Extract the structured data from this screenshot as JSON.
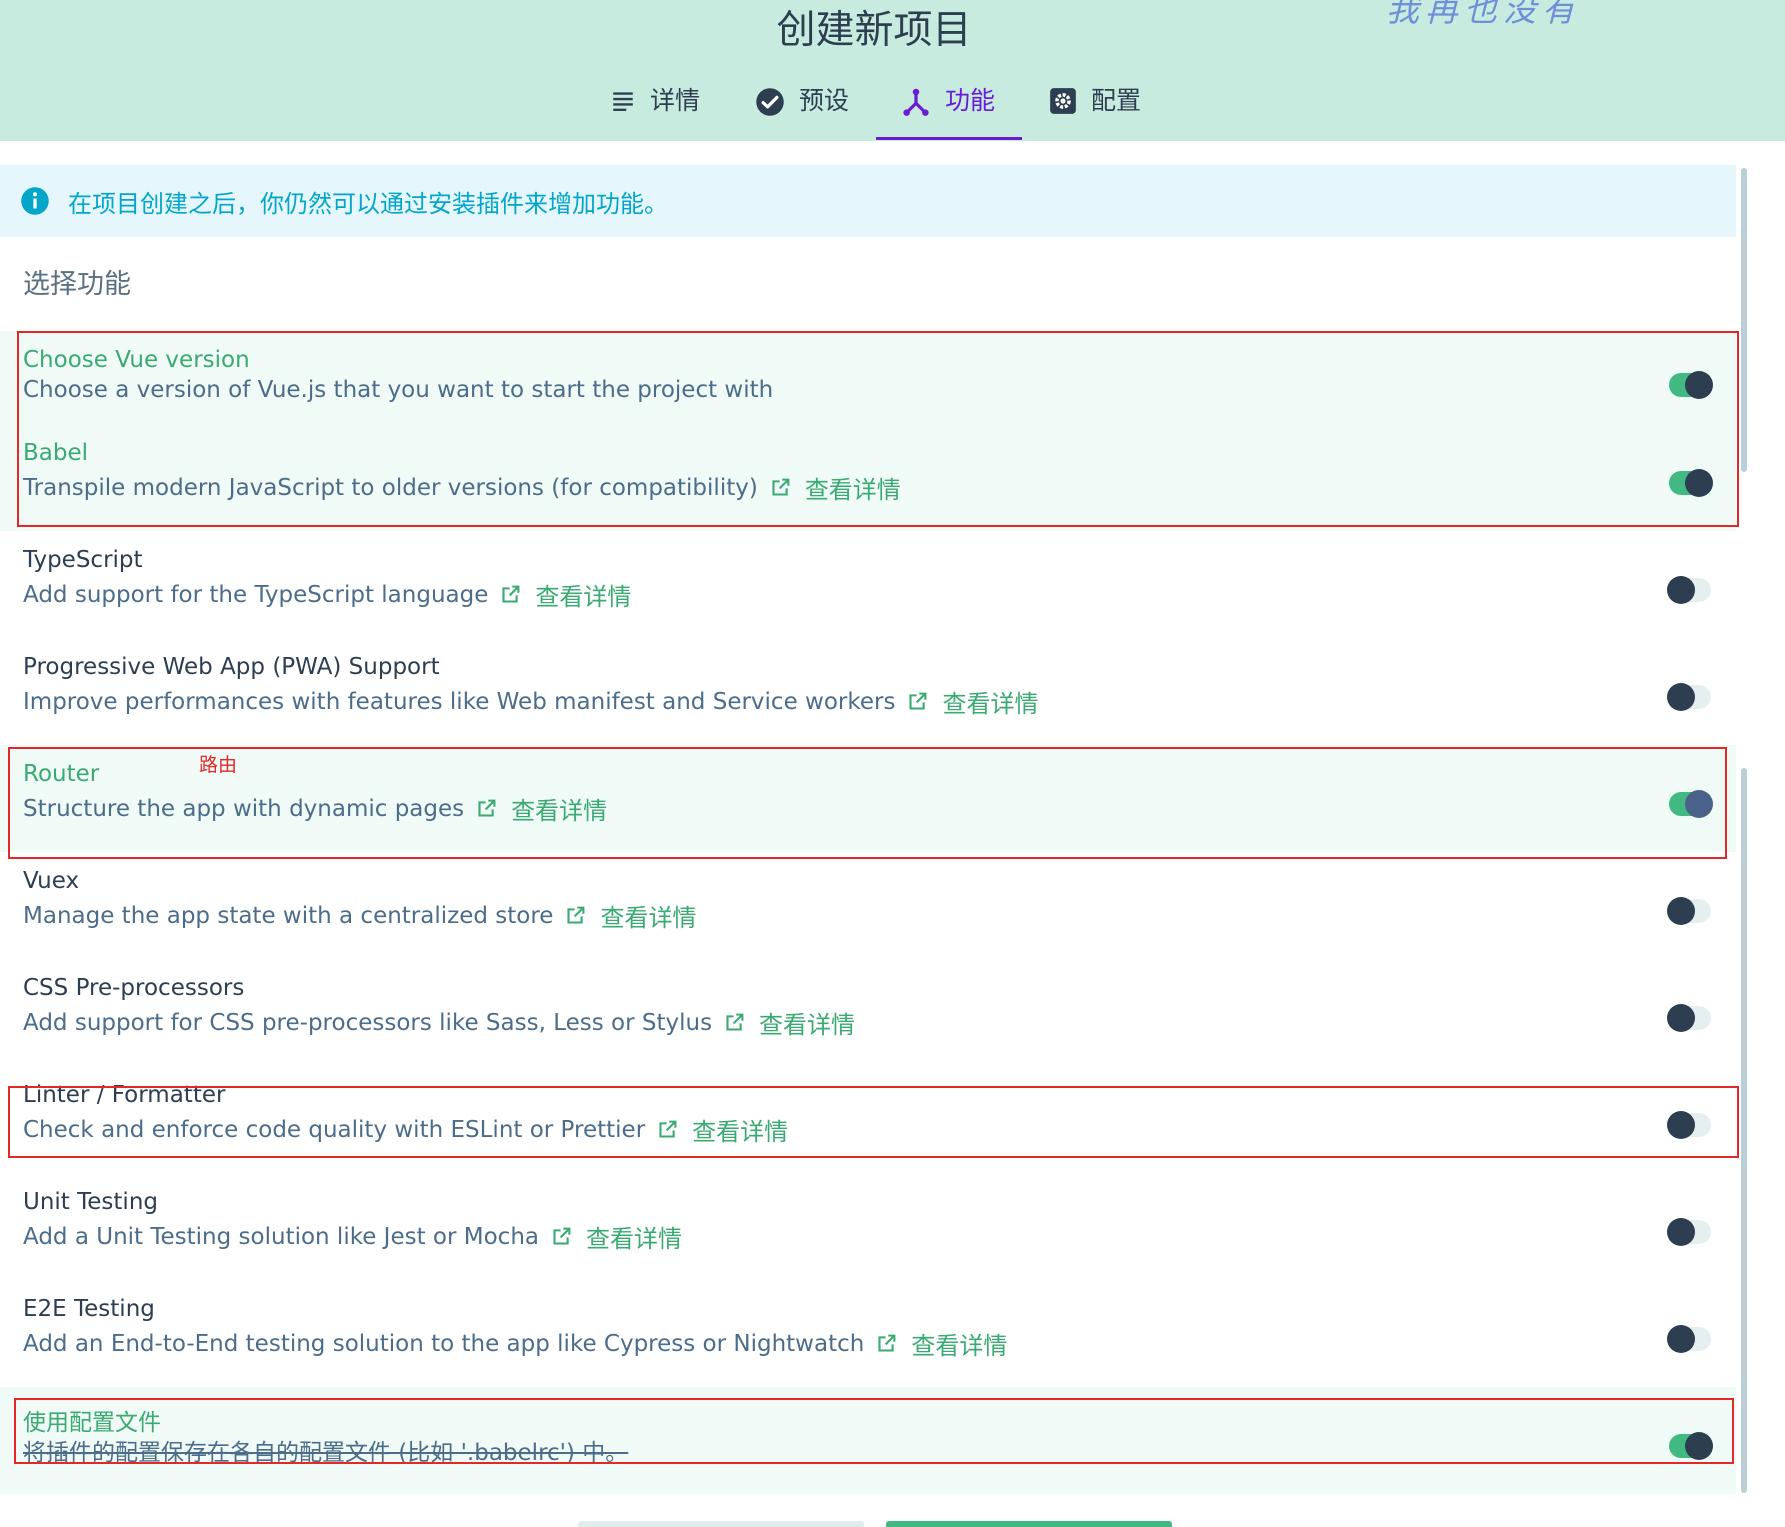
{
  "header": {
    "title": "创建新项目",
    "watermark": "我再也没有",
    "tabs": [
      {
        "label": "详情",
        "icon": "list-icon"
      },
      {
        "label": "预设",
        "icon": "check-circle-icon"
      },
      {
        "label": "功能",
        "icon": "fork-icon",
        "active": true
      },
      {
        "label": "配置",
        "icon": "settings-icon"
      }
    ]
  },
  "info": {
    "text": "在项目创建之后，你仍然可以通过安装插件来增加功能。"
  },
  "section_title": "选择功能",
  "more_link_label": "查看详情",
  "features": [
    {
      "name": "Choose Vue version",
      "desc": "Choose a version of Vue.js that you want to start the project with",
      "link": false,
      "enabled": true
    },
    {
      "name": "Babel",
      "desc": "Transpile modern JavaScript to older versions (for compatibility)",
      "link": true,
      "enabled": true
    },
    {
      "name": "TypeScript",
      "desc": "Add support for the TypeScript language",
      "link": true,
      "enabled": false
    },
    {
      "name": "Progressive Web App (PWA) Support",
      "desc": "Improve performances with features like Web manifest and Service workers",
      "link": true,
      "enabled": false
    },
    {
      "name": "Router",
      "desc": "Structure the app with dynamic pages",
      "link": true,
      "enabled": true
    },
    {
      "name": "Vuex",
      "desc": "Manage the app state with a centralized store",
      "link": true,
      "enabled": false
    },
    {
      "name": "CSS Pre-processors",
      "desc": "Add support for CSS pre-processors like Sass, Less or Stylus",
      "link": true,
      "enabled": false
    },
    {
      "name": "Linter / Formatter",
      "desc": "Check and enforce code quality with ESLint or Prettier",
      "link": true,
      "enabled": false
    },
    {
      "name": "Unit Testing",
      "desc": "Add a Unit Testing solution like Jest or Mocha",
      "link": true,
      "enabled": false
    },
    {
      "name": "E2E Testing",
      "desc": "Add an End-to-End testing solution to the app like Cypress or Nightwatch",
      "link": true,
      "enabled": false
    },
    {
      "name": "使用配置文件",
      "desc": "将插件的配置保存在各自的配置文件 (比如 '.babelrc') 中。",
      "link": false,
      "enabled": true
    }
  ],
  "annotation": {
    "text": "路由"
  },
  "colors": {
    "header_bg": "#c8ebdf",
    "accent_green": "#42b983",
    "active_tab": "#6a1bd3",
    "info_text": "#03a6c9",
    "annotation_red": "#e42828"
  }
}
